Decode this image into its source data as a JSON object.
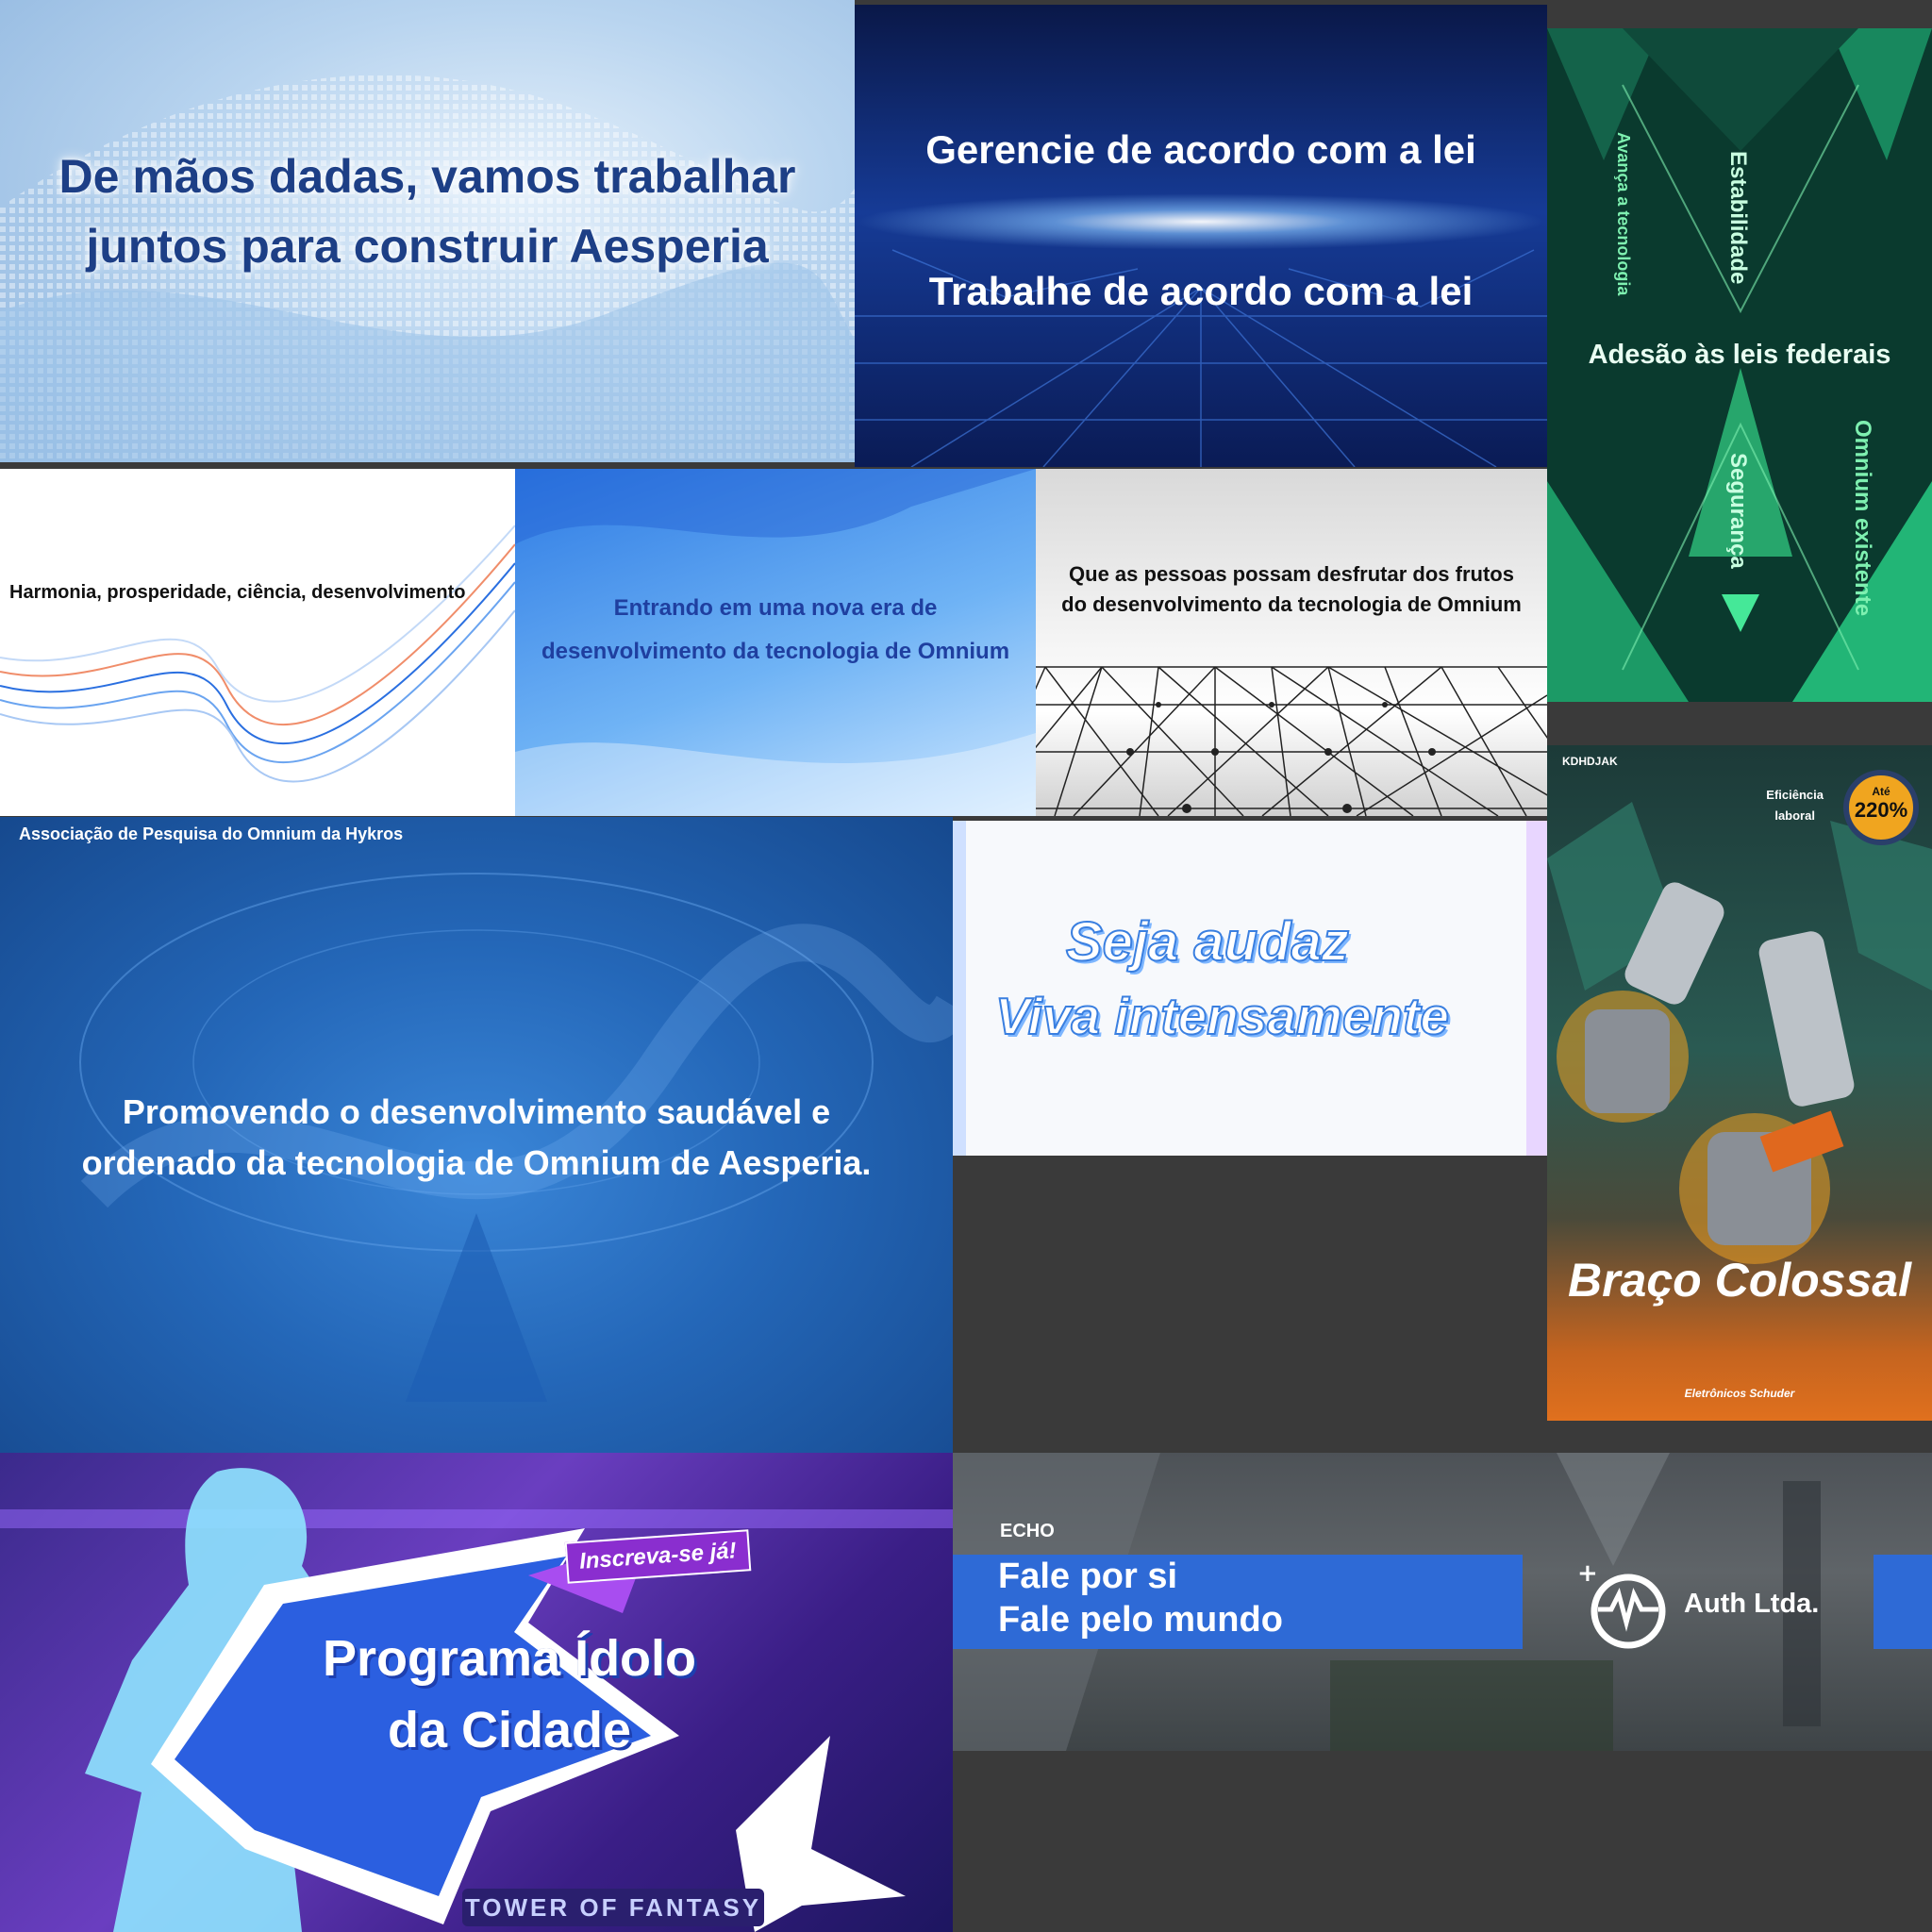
{
  "panels": {
    "p1": {
      "line1": "De mãos dadas, vamos trabalhar",
      "line2": "juntos para construir Aesperia"
    },
    "p2": {
      "line1": "Gerencie de acordo com a lei",
      "line2": "Trabalhe de acordo com a lei"
    },
    "p3": {
      "v_left": "Avança a tecnologia",
      "v_top": "Estabilidade",
      "center": "Adesão às leis federais",
      "v_bottom": "Segurança",
      "v_right": "Omnium existente"
    },
    "p4": {
      "text": "Harmonia, prosperidade, ciência, desenvolvimento"
    },
    "p5": {
      "line1": "Entrando em uma nova era de",
      "line2": "desenvolvimento da tecnologia de Omnium"
    },
    "p6": {
      "line1": "Que as pessoas possam desfrutar dos frutos",
      "line2": "do desenvolvimento da tecnologia de Omnium"
    },
    "p7": {
      "header": "Associação de Pesquisa do Omnium da Hykros",
      "line1": "Promovendo o desenvolvimento saudável e",
      "line2": "ordenado da tecnologia de Omnium de Aesperia."
    },
    "p8": {
      "line1": "Seja audaz",
      "line2": "Viva intensamente"
    },
    "p9": {
      "brand": "KDHDJAK",
      "eff1": "Eficiência",
      "eff2": "laboral",
      "badge_small": "Até",
      "badge_value": "220%",
      "name": "Braço Colossal",
      "company": "Eletrônicos Schuder"
    },
    "p10": {
      "cta": "Inscreva-se já!",
      "line1": "Programa Ídolo",
      "line2": "da Cidade",
      "logo": "TOWER OF FANTASY"
    },
    "p11": {
      "echo": "ECHO",
      "line1": "Fale por si",
      "line2": "Fale pelo mundo",
      "company": "Auth Ltda."
    }
  },
  "colors": {
    "background": "#3a3a3a",
    "accent_blue": "#2e6ad6",
    "green_text": "#7ef0b0",
    "badge_orange": "#f0a51f"
  }
}
